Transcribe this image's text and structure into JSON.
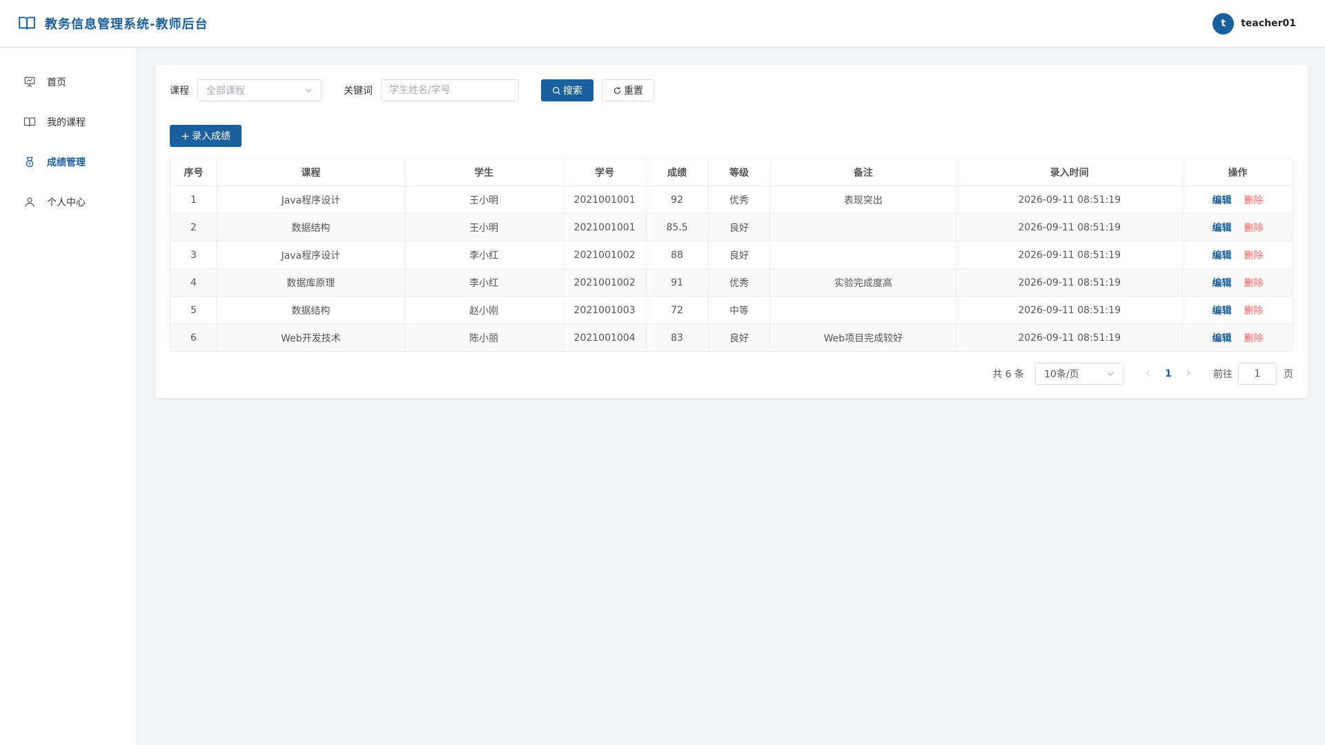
{
  "header": {
    "title": "教务信息管理系统-教师后台",
    "avatar_letter": "t",
    "username": "teacher01",
    "accent": "#1a5f9e"
  },
  "sidebar": {
    "items": [
      {
        "label": "首页",
        "icon": "presentation-board-icon",
        "active": false
      },
      {
        "label": "我的课程",
        "icon": "book-icon",
        "active": false
      },
      {
        "label": "成绩管理",
        "icon": "medal-icon",
        "active": true
      },
      {
        "label": "个人中心",
        "icon": "user-icon",
        "active": false
      }
    ]
  },
  "filters": {
    "course_label": "课程",
    "course_placeholder": "全部课程",
    "keyword_label": "关键词",
    "keyword_placeholder": "学生姓名/学号",
    "search_label": "搜索",
    "reset_label": "重置"
  },
  "toolbar": {
    "add_label": "录入成绩"
  },
  "table": {
    "columns": [
      "序号",
      "课程",
      "学生",
      "学号",
      "成绩",
      "等级",
      "备注",
      "录入时间",
      "操作"
    ],
    "rows": [
      {
        "no": "1",
        "course": "Java程序设计",
        "student": "王小明",
        "sid": "2021001001",
        "score": "92",
        "grade": "优秀",
        "note": "表现突出",
        "time": "2026-09-11 08:51:19"
      },
      {
        "no": "2",
        "course": "数据结构",
        "student": "王小明",
        "sid": "2021001001",
        "score": "85.5",
        "grade": "良好",
        "note": "",
        "time": "2026-09-11 08:51:19"
      },
      {
        "no": "3",
        "course": "Java程序设计",
        "student": "李小红",
        "sid": "2021001002",
        "score": "88",
        "grade": "良好",
        "note": "",
        "time": "2026-09-11 08:51:19"
      },
      {
        "no": "4",
        "course": "数据库原理",
        "student": "李小红",
        "sid": "2021001002",
        "score": "91",
        "grade": "优秀",
        "note": "实验完成度高",
        "time": "2026-09-11 08:51:19"
      },
      {
        "no": "5",
        "course": "数据结构",
        "student": "赵小刚",
        "sid": "2021001003",
        "score": "72",
        "grade": "中等",
        "note": "",
        "time": "2026-09-11 08:51:19"
      },
      {
        "no": "6",
        "course": "Web开发技术",
        "student": "陈小丽",
        "sid": "2021001004",
        "score": "83",
        "grade": "良好",
        "note": "Web项目完成较好",
        "time": "2026-09-11 08:51:19"
      }
    ],
    "edit_label": "编辑",
    "delete_label": "删除"
  },
  "pagination": {
    "total_text": "共 6 条",
    "page_size": "10条/页",
    "current_page": "1",
    "goto_label": "前往",
    "goto_value": "1",
    "goto_unit": "页"
  }
}
